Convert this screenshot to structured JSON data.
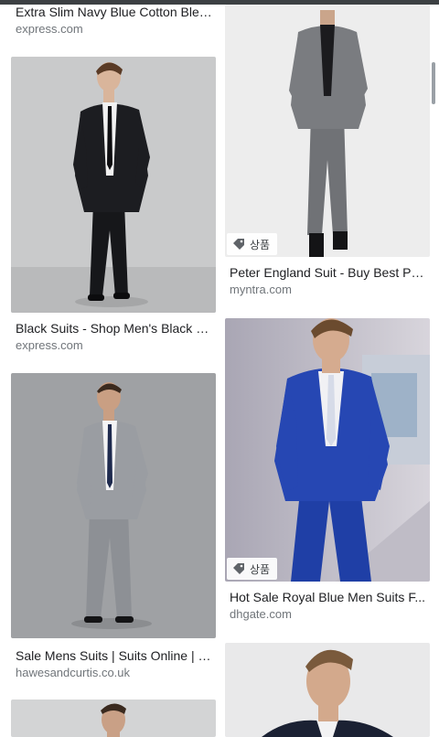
{
  "results": [
    {
      "title": "Extra Slim Navy Blue Cotton Blen...",
      "source": "express.com"
    },
    {
      "title": "Peter England Suit - Buy Best Pe...",
      "source": "myntra.com",
      "badge": "상품"
    },
    {
      "title": "Black Suits - Shop Men's Black S...",
      "source": "express.com"
    },
    {
      "title": "Hot Sale Royal Blue Men Suits F...",
      "source": "dhgate.com",
      "badge": "상품"
    },
    {
      "title": "Sale Mens Suits | Suits Online | M...",
      "source": "hawesandcurtis.co.uk"
    }
  ],
  "colors": {
    "title": "#202124",
    "source": "#70757a"
  }
}
